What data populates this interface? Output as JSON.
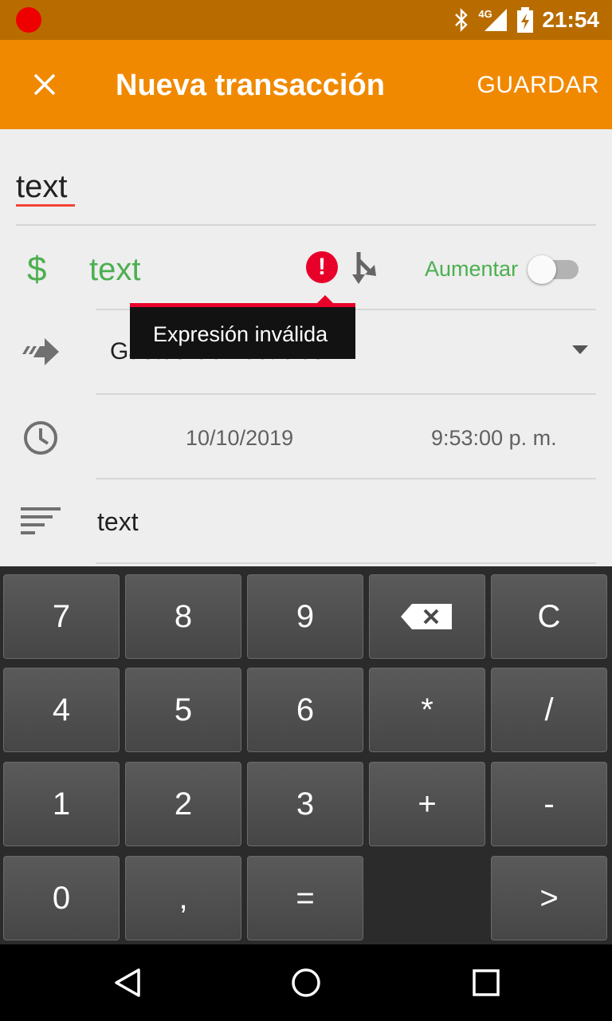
{
  "status_bar": {
    "time": "21:54",
    "network": "4G"
  },
  "toolbar": {
    "title": "Nueva transacción",
    "save_label": "GUARDAR"
  },
  "form": {
    "description_value": "text",
    "currency_symbol": "$",
    "amount_value": "text",
    "increase_label": "Aumentar",
    "account_value": "Gastos:Comestibles",
    "date_value": "10/10/2019",
    "time_value": "9:53:00 p. m.",
    "notes_value": "text"
  },
  "tooltip": {
    "message": "Expresión inválida"
  },
  "keypad": {
    "keys": [
      "7",
      "8",
      "9",
      "⌫",
      "C",
      "4",
      "5",
      "6",
      "*",
      "/",
      "1",
      "2",
      "3",
      "+",
      "-",
      "0",
      ",",
      "=",
      "",
      ">"
    ]
  },
  "colors": {
    "accent": "#f08900",
    "status_bar": "#b86c00",
    "positive": "#4caf50",
    "error": "#e8002a"
  }
}
